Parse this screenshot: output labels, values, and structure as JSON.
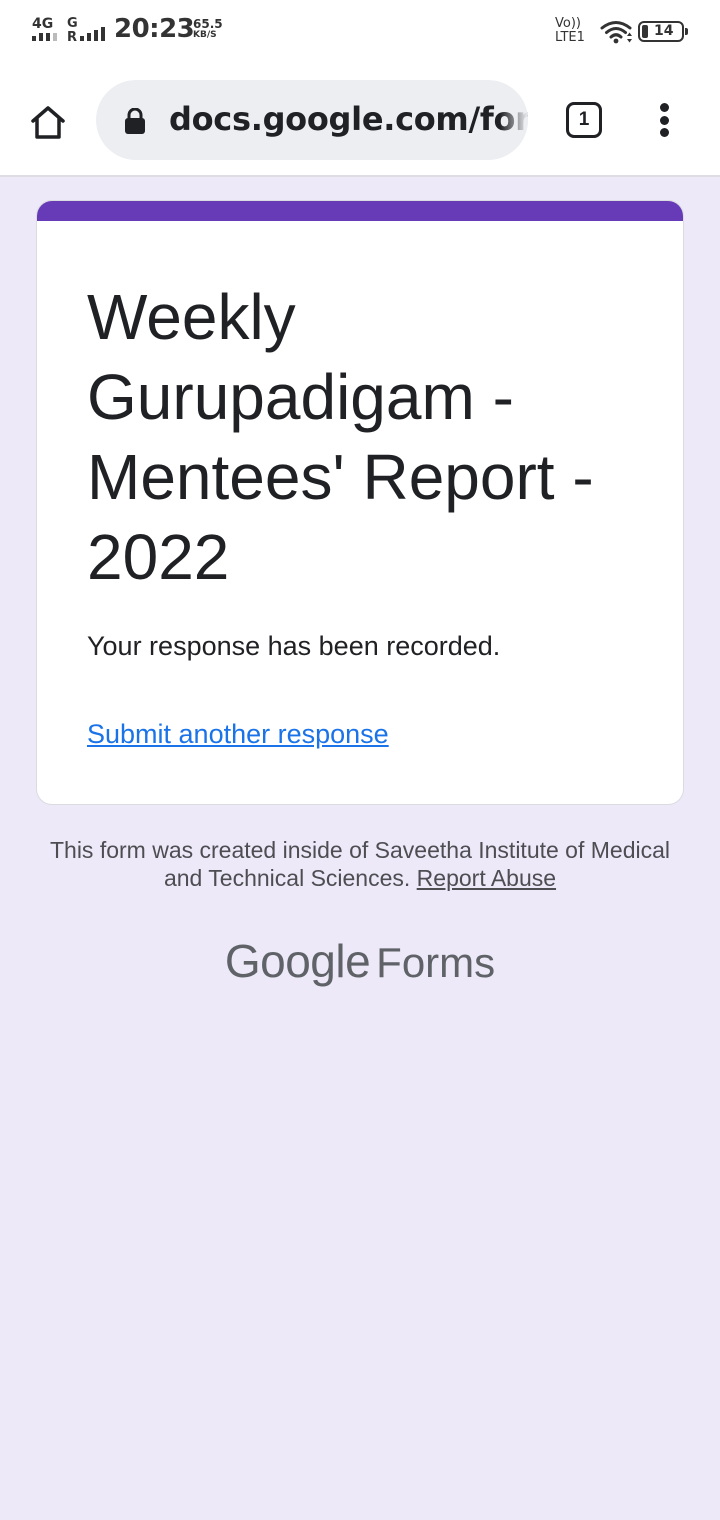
{
  "status_bar": {
    "network_1": "4G",
    "network_2_top": "G",
    "network_2_bottom": "R",
    "time": "20:23",
    "speed_value": "65.5",
    "speed_unit": "KB/S",
    "volte_top": "Vo))",
    "volte_bottom": "LTE1",
    "battery_level": "14"
  },
  "browser": {
    "home_icon": "home-icon",
    "url": "docs.google.com/forms",
    "tab_count": "1",
    "menu_icon": "more-vert-icon"
  },
  "form": {
    "accent_color": "#673ab7",
    "title": "Weekly Gurupadigam - Mentees' Report - 2022",
    "confirmation": "Your response has been recorded.",
    "submit_another": "Submit another response"
  },
  "footer": {
    "note": "This form was created inside of Saveetha Institute of Medical and Technical Sciences.",
    "report_abuse": "Report Abuse",
    "brand_google": "Google",
    "brand_forms": "Forms"
  },
  "colors": {
    "page_background": "#ede9f8",
    "link": "#1a73e8"
  }
}
